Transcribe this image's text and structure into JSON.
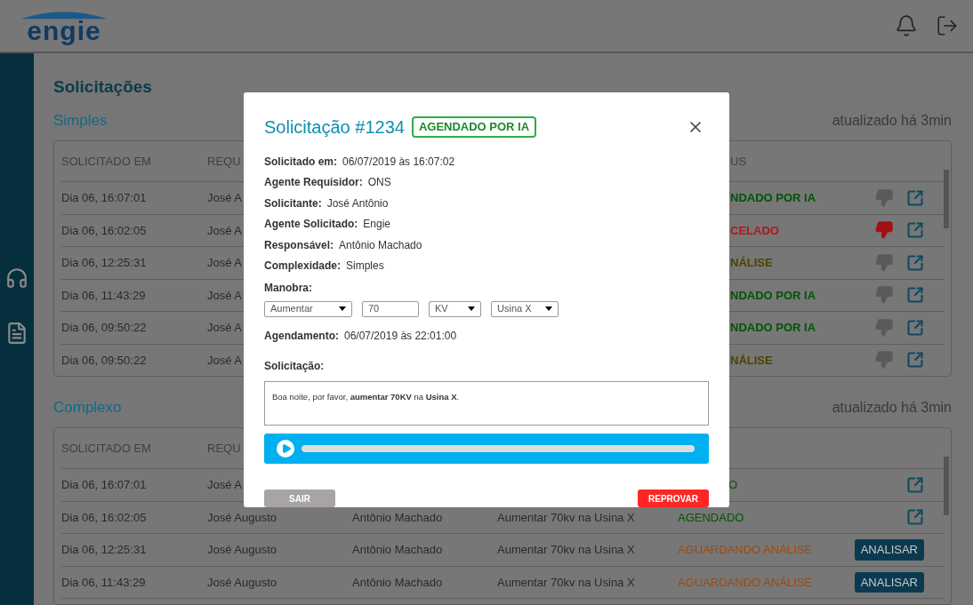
{
  "header": {
    "logo": "engie"
  },
  "page_title": "Solicitações",
  "simple": {
    "title": "Simples",
    "updated": "atualizado há 3min",
    "columns": [
      "SOLICITADO EM",
      "REQU",
      "US"
    ],
    "rows": [
      {
        "date": "Dia 06, 16:07:01",
        "requester": "José A",
        "status": "NDADO POR IA",
        "color": "#045404",
        "disliked": false
      },
      {
        "date": "Dia 06, 16:02:05",
        "requester": "José A",
        "status": "CELADO",
        "color": "#b01818",
        "disliked": true
      },
      {
        "date": "Dia 06, 12:25:31",
        "requester": "José A",
        "status": "NÁLISE",
        "color": "#4e4200",
        "disliked": false
      },
      {
        "date": "Dia 06, 11:43:29",
        "requester": "José A",
        "status": "NDADO POR IA",
        "color": "#045404",
        "disliked": false
      },
      {
        "date": "Dia 06, 09:50:22",
        "requester": "José A",
        "status": "NDADO POR IA",
        "color": "#045404",
        "disliked": false
      },
      {
        "date": "Dia 06, 09:50:22",
        "requester": "José A",
        "status": "NÁLISE",
        "color": "#4e4200",
        "disliked": false
      }
    ]
  },
  "complex": {
    "title": "Complexo",
    "updated": "atualizado há 3min",
    "columns": [
      "SOLICITADO EM",
      "REQU"
    ],
    "rows": [
      {
        "date": "Dia 06, 16:07:01",
        "requester": "José A",
        "status": "O",
        "color": "#045404",
        "action": {
          "kind": "open"
        }
      },
      {
        "date": "Dia 06, 16:02:05",
        "requester": "José Augusto",
        "responsible": "Antônio Machado",
        "description": "Aumentar 70kv na Usina X",
        "status": "AGENDADO",
        "color": "#045404",
        "action": {
          "kind": "open"
        }
      },
      {
        "date": "Dia 06, 12:25:31",
        "requester": "José Augusto",
        "responsible": "Antônio Machado",
        "description": "Aumentar 70kv na Usina X",
        "status": "AGUARDANDO ANÁLISE",
        "color": "#9c4a10",
        "action": {
          "kind": "analyze",
          "label": "ANALISAR"
        }
      },
      {
        "date": "Dia 06, 11:43:29",
        "requester": "José Augusto",
        "responsible": "Antônio Machado",
        "description": "Aumentar 70kv na Usina X",
        "status": "AGUARDANDO ANÁLISE",
        "color": "#9c4a10",
        "action": {
          "kind": "analyze",
          "label": "ANALISAR"
        }
      }
    ]
  },
  "modal": {
    "title": "Solicitação #1234",
    "badge": "AGENDADO POR IA",
    "fields": [
      {
        "label": "Solicitado em:",
        "value": "06/07/2019 às 16:07:02"
      },
      {
        "label": "Agente Requisidor:",
        "value": "ONS"
      },
      {
        "label": "Solicitante:",
        "value": "José Antônio"
      },
      {
        "label": "Agente Solicitado:",
        "value": "Engie"
      },
      {
        "label": "Responsável:",
        "value": "Antônio Machado"
      },
      {
        "label": "Complexidade:",
        "value": "Simples"
      }
    ],
    "maneuver_label": "Manobra:",
    "maneuver": [
      {
        "kind": "select",
        "value": "Aumentar"
      },
      {
        "kind": "input",
        "value": "70"
      },
      {
        "kind": "select",
        "value": "KV"
      },
      {
        "kind": "select",
        "value": "Usina X"
      }
    ],
    "schedule": {
      "label": "Agendamento:",
      "value": "06/07/2019 às 22:01:00"
    },
    "request_label": "Solicitação:",
    "request_text": "Boa noite, por favor, **aumentar 70KV** na **Usina X**.",
    "buttons": [
      {
        "kind": "secondary",
        "label": "SAIR"
      },
      {
        "kind": "danger",
        "label": "REPROVAR"
      }
    ]
  }
}
